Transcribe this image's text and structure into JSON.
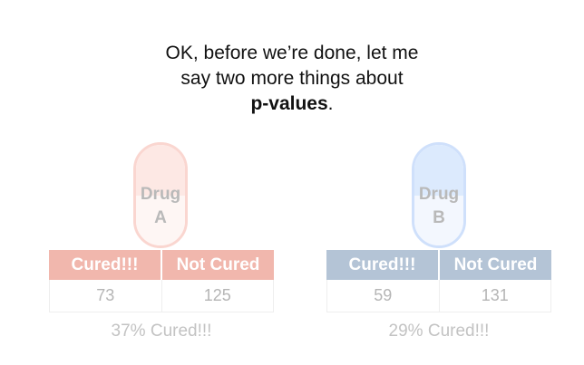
{
  "headline": {
    "line1": "OK, before we’re done, let me",
    "line2": "say two more things about",
    "line3_bold": "p-values",
    "line3_suffix": "."
  },
  "drug_a": {
    "pill_word": "Drug",
    "pill_letter": "A",
    "table": {
      "headers": [
        "Cured!!!",
        "Not Cured"
      ],
      "values": [
        "73",
        "125"
      ]
    },
    "summary": "37% Cured!!!"
  },
  "drug_b": {
    "pill_word": "Drug",
    "pill_letter": "B",
    "table": {
      "headers": [
        "Cured!!!",
        "Not Cured"
      ],
      "values": [
        "59",
        "131"
      ]
    },
    "summary": "29% Cured!!!"
  },
  "colors": {
    "drug_a_header": "#f1b7ad",
    "drug_b_header": "#b4c4d6",
    "pill_a_outline": "#fad6d0",
    "pill_b_outline": "#cfe0fb"
  }
}
